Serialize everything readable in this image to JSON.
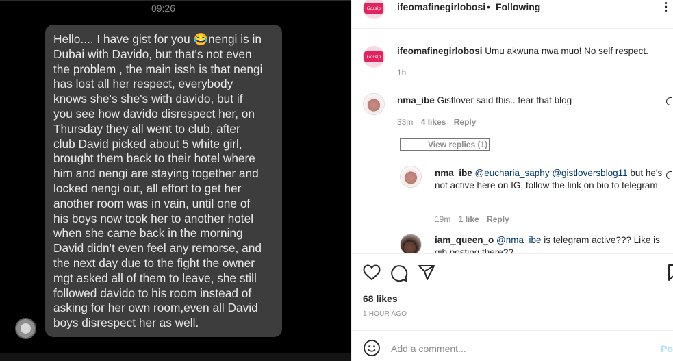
{
  "photo": {
    "status_time": "09:26",
    "message_lines": [
      "Hello.... I have gist for you 😂nengi is in",
      "Dubai with Davido, but that's not even",
      "the problem , the main issh is that nengi",
      "has lost all her respect, everybody",
      "knows she's she's with davido, but if",
      "you see how davido disrespect her, on",
      "Thursday they all went to club, after",
      "club David picked about 5 white girl,",
      "brought them back to their hotel where",
      "him and nengi are staying together and",
      "locked nengi out,  all effort to get her",
      "another room was in vain, until one of",
      "his boys now took her to another hotel",
      "when she came back in the morning",
      "David didn't even feel any remorse, and",
      "the next day due to the fight the owner",
      "mgt asked all of them to leave, she still",
      "followed davido to his room instead of",
      "asking for her own room,even all David",
      "boys disrespect her as well."
    ]
  },
  "header": {
    "avatar_text": "Gossip",
    "username": "ifeomafinegirlobosi",
    "separator": "•",
    "follow_label": "Following",
    "more_icon": "more-options-icon",
    "more_glyph": "⋮"
  },
  "caption": {
    "avatar_text": "Gossip",
    "username": "ifeomafinegirlobosi",
    "text": "Umu akwuna nwa muo! No self respect.",
    "time": "1h"
  },
  "comments": [
    {
      "username": "nma_ibe",
      "text": "Gistlover said this.. fear that blog",
      "time": "33m",
      "likes": "4 likes",
      "reply_label": "Reply"
    }
  ],
  "view_replies_label": "View replies (1)",
  "replies": [
    {
      "username": "nma_ibe",
      "text": "@eucharia_saphy @gistloversblog11 but he's not active here on IG, follow the link on bio to telegram",
      "time": "19m",
      "likes": "1 like",
      "reply_label": "Reply"
    },
    {
      "username": "iam_queen_o",
      "text": "@nma_ibe is telegram active??? Like is gib posting there??",
      "time": "",
      "likes": "",
      "reply_label": ""
    }
  ],
  "actions": {
    "likes_count": "68 likes",
    "posted_ago": "1 HOUR AGO",
    "icons": [
      "heart-icon",
      "comment-icon",
      "share-icon",
      "bookmark-icon"
    ]
  },
  "add_comment": {
    "placeholder": "Add a comment...",
    "post_label": "Po"
  },
  "colors": {
    "accent": "#e0245e",
    "link": "#0095f6",
    "muted": "#8e8e8e"
  }
}
